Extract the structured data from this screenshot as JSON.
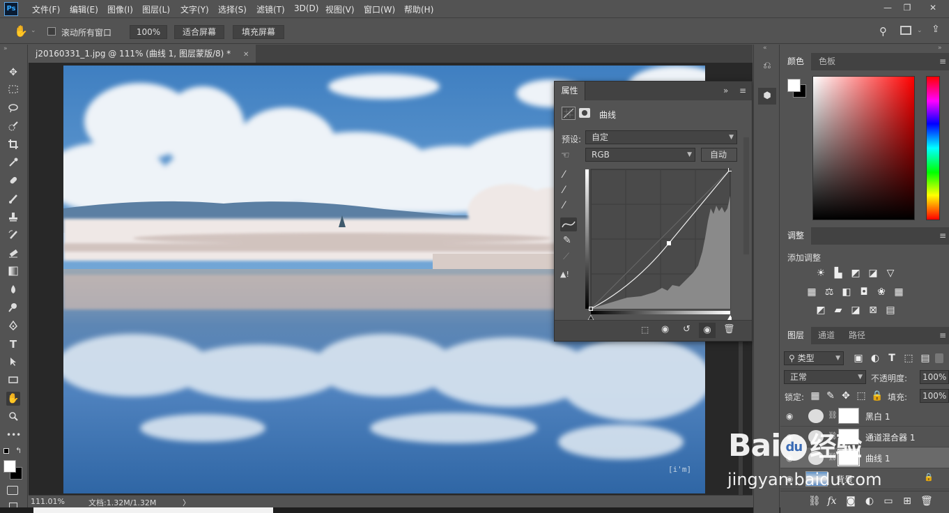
{
  "app": {
    "logo": "Ps"
  },
  "menu": [
    "文件(F)",
    "编辑(E)",
    "图像(I)",
    "图层(L)",
    "文字(Y)",
    "选择(S)",
    "滤镜(T)",
    "3D(D)",
    "视图(V)",
    "窗口(W)",
    "帮助(H)"
  ],
  "window_controls": {
    "minimize": "—",
    "restore": "❐",
    "close": "✕"
  },
  "options": {
    "scroll_all": "滚动所有窗口",
    "zoom": "100%",
    "fit_screen": "适合屏幕",
    "fill_screen": "填充屏幕"
  },
  "document": {
    "tab_title": "j20160331_1.jpg @ 111% (曲线 1, 图层蒙版/8) *",
    "close": "✕"
  },
  "status": {
    "zoom": "111.01%",
    "doc_info": "文档:1.32M/1.32M",
    "arrow": "〉"
  },
  "properties": {
    "tab": "属性",
    "type_label": "曲线",
    "preset_label": "预设:",
    "preset_value": "自定",
    "channel": "RGB",
    "auto": "自动",
    "curve_points": [
      [
        0,
        0
      ],
      [
        0.56,
        0.47
      ],
      [
        1,
        1
      ]
    ]
  },
  "color_panel": {
    "tab_color": "颜色",
    "tab_swatches": "色板",
    "fg": "#ffffff",
    "bg": "#000000"
  },
  "adjust_panel": {
    "tab": "调整",
    "add_label": "添加调整"
  },
  "layers_panel": {
    "tab_layers": "图层",
    "tab_channels": "通道",
    "tab_paths": "路径",
    "filter_kind": "类型",
    "blend": "正常",
    "opacity_label": "不透明度:",
    "opacity": "100%",
    "lock_label": "锁定:",
    "fill_label": "填充:",
    "fill": "100%",
    "layers": [
      {
        "name": "黑白 1"
      },
      {
        "name": "通道混合器 1"
      },
      {
        "name": "曲线 1"
      },
      {
        "name": "背景"
      }
    ]
  },
  "watermark": {
    "brand": "Bai",
    "paw": "du",
    "cn": "经验",
    "url": "jingyan.baidu.com",
    "photo_mark": "[i'm]"
  }
}
